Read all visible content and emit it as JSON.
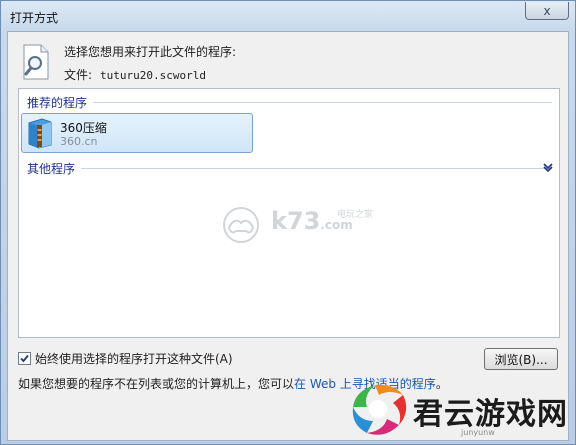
{
  "window": {
    "title": "打开方式",
    "close_label": "x"
  },
  "header": {
    "prompt": "选择您想用来打开此文件的程序:",
    "file_label": "文件:",
    "file_name": "tuturu20.scworld"
  },
  "program_list": {
    "recommended_label": "推荐的程序",
    "other_label": "其他程序",
    "items": [
      {
        "name": "360压缩",
        "publisher": "360.cn",
        "icon": "360-zip-icon"
      }
    ]
  },
  "watermark": {
    "text": "k73",
    "sub": "电玩之家",
    "suffix": ".com"
  },
  "footer": {
    "always_use_label": "始终使用选择的程序打开这种文件(A)",
    "always_use_checked": true,
    "browse_label": "浏览(B)...",
    "help_prefix": "如果您想要的程序不在列表或您的计算机上，您可以",
    "help_link": "在 Web 上寻找适当的程序",
    "help_suffix": "。"
  },
  "brand": {
    "name": "君云游戏网",
    "sub": "junyunw"
  },
  "colors": {
    "link": "#1a56b0",
    "group_header": "#1e3287",
    "selection": "#cfe6f8"
  }
}
